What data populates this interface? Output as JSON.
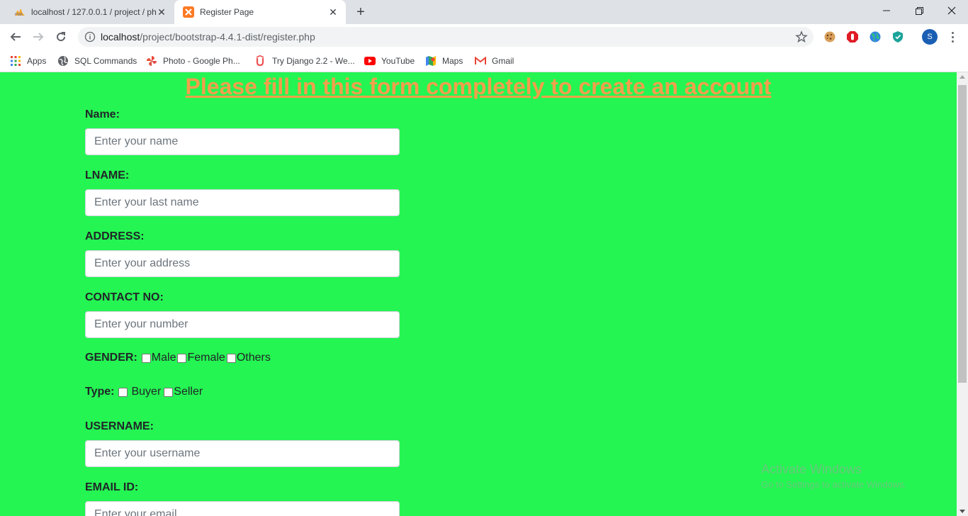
{
  "browser": {
    "tabs": [
      {
        "title": "localhost / 127.0.0.1 / project / ph",
        "favicon": "phpmyadmin-icon"
      },
      {
        "title": "Register Page",
        "favicon": "xampp-icon"
      }
    ],
    "url_host": "localhost",
    "url_path": "/project/bootstrap-4.4.1-dist/register.php",
    "profile_initial": "S"
  },
  "bookmarks": [
    {
      "label": "Apps",
      "icon": "apps-grid-icon"
    },
    {
      "label": "SQL Commands",
      "icon": "globe-icon"
    },
    {
      "label": "Photo - Google Ph...",
      "icon": "google-photos-icon"
    },
    {
      "label": "Try Django 2.2 - We...",
      "icon": "udemy-icon"
    },
    {
      "label": "YouTube",
      "icon": "youtube-icon"
    },
    {
      "label": "Maps",
      "icon": "maps-icon"
    },
    {
      "label": "Gmail",
      "icon": "gmail-icon"
    }
  ],
  "form": {
    "heading": "Please fill in this form completely to create an account",
    "name_label": "Name:",
    "name_placeholder": "Enter your name",
    "lname_label": "LNAME:",
    "lname_placeholder": "Enter your last name",
    "address_label": "ADDRESS:",
    "address_placeholder": "Enter your address",
    "contact_label": "CONTACT NO:",
    "contact_placeholder": "Enter your number",
    "gender_label": "GENDER:",
    "gender_options": [
      "Male",
      "Female",
      "Others"
    ],
    "type_label": "Type:",
    "type_options": [
      "Buyer",
      "Seller"
    ],
    "username_label": "USERNAME:",
    "username_placeholder": "Enter your username",
    "email_label": "EMAIL ID:",
    "email_placeholder": "Enter your email"
  },
  "watermark": {
    "line1": "Activate Windows",
    "line2": "Go to Settings to activate Windows."
  },
  "colors": {
    "page_background": "#24f552",
    "heading": "#f0a04b"
  }
}
